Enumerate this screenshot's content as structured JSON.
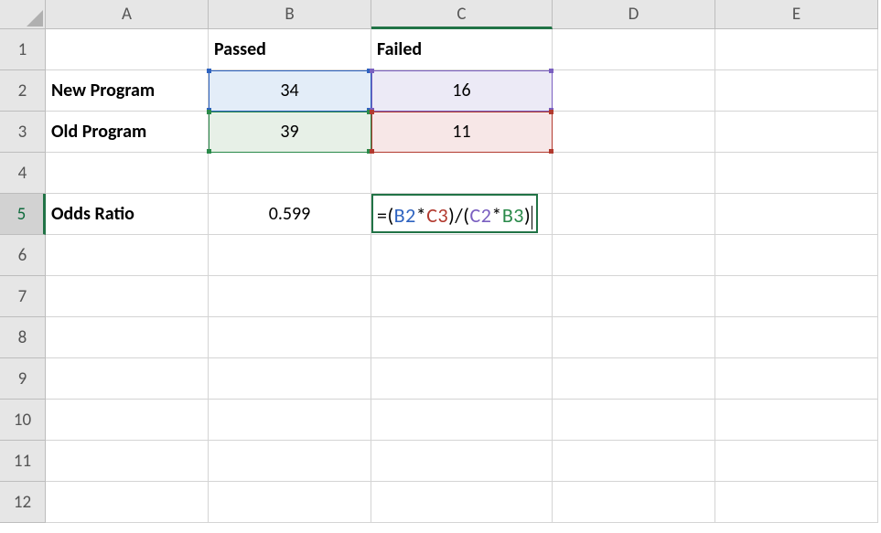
{
  "columns": [
    "A",
    "B",
    "C",
    "D",
    "E"
  ],
  "rows": [
    "1",
    "2",
    "3",
    "4",
    "5",
    "6",
    "7",
    "8",
    "9",
    "10",
    "11",
    "12"
  ],
  "cells": {
    "B1": "Passed",
    "C1": "Failed",
    "A2": "New Program",
    "B2": "34",
    "C2": "16",
    "A3": "Old Program",
    "B3": "39",
    "C3": "11",
    "A5": "Odds Ratio",
    "B5": "0.599"
  },
  "formula": {
    "eq": "=",
    "lp1": "(",
    "b2": "B2",
    "star1": "*",
    "c3": "C3",
    "rp1": ")",
    "slash": "/",
    "lp2": "(",
    "c2": "C2",
    "star2": "*",
    "b3": "B3",
    "rp2": ")"
  },
  "active_cell": "C5",
  "formula_text": "=(B2*C3)/(C2*B3)"
}
